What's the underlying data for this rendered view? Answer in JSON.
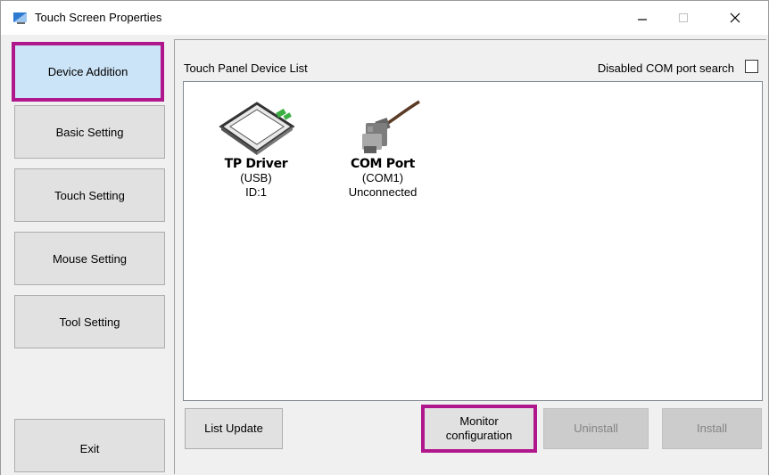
{
  "window": {
    "title": "Touch Screen Properties",
    "controls": {
      "minimize": "—",
      "maximize": "☐",
      "close": "✕"
    }
  },
  "sidebar": {
    "items": [
      {
        "label": "Device Addition",
        "active": true
      },
      {
        "label": "Basic Setting"
      },
      {
        "label": "Touch Setting"
      },
      {
        "label": "Mouse Setting"
      },
      {
        "label": "Tool Setting"
      }
    ],
    "exit_label": "Exit"
  },
  "main": {
    "list_title": "Touch Panel Device List",
    "com_search_label": "Disabled COM port search",
    "com_search_checked": false,
    "devices": [
      {
        "name": "TP Driver",
        "line1": "(USB)",
        "line2": "ID:1",
        "icon": "touch-panel-icon"
      },
      {
        "name": "COM Port",
        "line1": "(COM1)",
        "line2": "Unconnected",
        "icon": "serial-cable-icon"
      }
    ]
  },
  "buttons": {
    "list_update": "List Update",
    "monitor_line1": "Monitor",
    "monitor_line2": "configuration",
    "uninstall": "Uninstall",
    "install": "Install"
  },
  "colors": {
    "highlight": "#b0178c",
    "active_bg": "#cce4f7",
    "disabled_text": "#838383"
  }
}
